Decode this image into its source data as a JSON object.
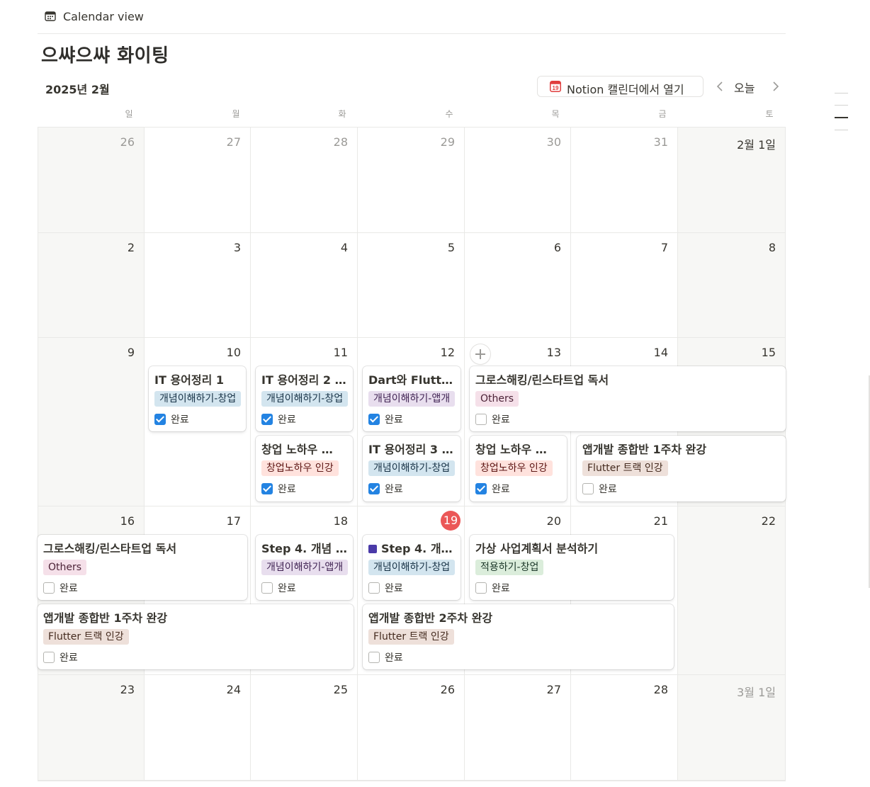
{
  "view": {
    "title": "Calendar view",
    "icon": "calendar-view-icon"
  },
  "page_title": "으쌰으쌰 화이팅",
  "toolbar": {
    "month_label": "2025년 2월",
    "open_button": {
      "label": "Notion 캘린더에서 열기",
      "icon": "notion-calendar-icon",
      "icon_text": "19"
    },
    "today_label": "오늘",
    "prev_icon": "chevron-left-icon",
    "next_icon": "chevron-right-icon"
  },
  "weekdays": [
    "일",
    "월",
    "화",
    "수",
    "목",
    "금",
    "토"
  ],
  "weeks": [
    {
      "days": [
        "26",
        "27",
        "28",
        "29",
        "30",
        "31",
        "2월 1일"
      ]
    },
    {
      "days": [
        "2",
        "3",
        "4",
        "5",
        "6",
        "7",
        "8"
      ]
    },
    {
      "days": [
        "9",
        "10",
        "11",
        "12",
        "13",
        "14",
        "15"
      ]
    },
    {
      "days": [
        "16",
        "17",
        "18",
        "19",
        "20",
        "21",
        "22"
      ]
    },
    {
      "days": [
        "23",
        "24",
        "25",
        "26",
        "27",
        "28",
        "3월 1일"
      ]
    }
  ],
  "today": "19",
  "check_label": "완료",
  "colors": {
    "today_badge": "#eb5757",
    "checkbox_checked": "#2383e2",
    "tag_blue_bg": "#d3e5ef",
    "tag_blue_text": "#183347",
    "tag_purple_bg": "#e8deee",
    "tag_purple_text": "#412454",
    "tag_pink_bg": "#f5e0e9",
    "tag_pink_text": "#4c2337",
    "tag_red_bg": "#ffe2dd",
    "tag_red_text": "#5d1715",
    "tag_brown_bg": "#eee0da",
    "tag_brown_text": "#442a1e",
    "tag_green_bg": "#dbeddb",
    "tag_green_text": "#1c3829"
  },
  "events": [
    {
      "title": "IT 용어정리 1",
      "tag": "개념이해하기-창업",
      "tag_color": "blue",
      "done": true
    },
    {
      "title": "IT 용어정리 2 (…",
      "tag": "개념이해하기-창업",
      "tag_color": "blue",
      "done": true
    },
    {
      "title": "Dart와 Flutter…",
      "tag": "개념이해하기-앱개",
      "tag_color": "purple",
      "done": true
    },
    {
      "title": "그로스해킹/린스타트업 독서",
      "tag": "Others",
      "tag_color": "pink",
      "done": false
    },
    {
      "title": "창업 노하우 …",
      "tag": "창업노하우 인강",
      "tag_color": "red",
      "done": true
    },
    {
      "title": "IT 용어정리 3 (…",
      "tag": "개념이해하기-창업",
      "tag_color": "blue",
      "done": true
    },
    {
      "title": "창업 노하우 …",
      "tag": "창업노하우 인강",
      "tag_color": "red",
      "done": true
    },
    {
      "title": "앱개발 종합반 1주차 완강",
      "tag": "Flutter 트랙 인강",
      "tag_color": "brown",
      "done": false
    },
    {
      "title": "그로스해킹/린스타트업 독서",
      "tag": "Others",
      "tag_color": "pink",
      "done": false
    },
    {
      "title": "Step 4. 개념 …",
      "tag": "개념이해하기-앱개",
      "tag_color": "purple",
      "done": false
    },
    {
      "title": "Step 4. 개…",
      "title_icon": "movie-clapper-icon",
      "tag": "개념이해하기-창업",
      "tag_color": "blue",
      "done": false
    },
    {
      "title": "가상 사업계획서 분석하기",
      "tag": "적용하기-창업",
      "tag_color": "green",
      "done": false
    },
    {
      "title": "앱개발 종합반 1주차 완강",
      "tag": "Flutter 트랙 인강",
      "tag_color": "brown",
      "done": false
    },
    {
      "title": "앱개발 종합반 2주차 완강",
      "tag": "Flutter 트랙 인강",
      "tag_color": "brown",
      "done": false
    }
  ]
}
